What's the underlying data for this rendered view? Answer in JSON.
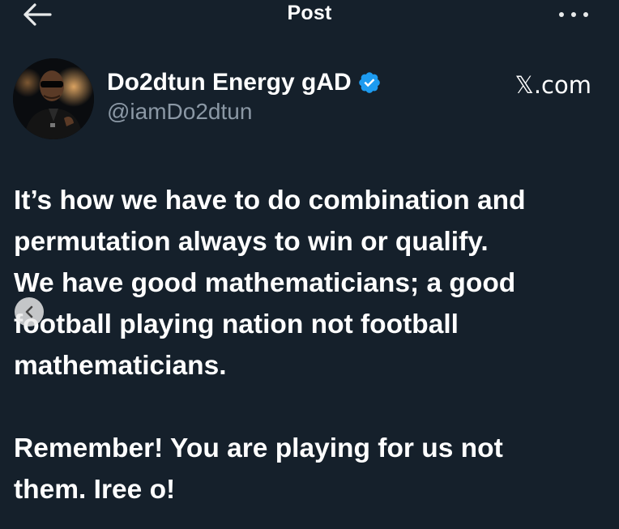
{
  "header": {
    "title": "Post",
    "back_icon": "arrow-left-icon",
    "more_icon": "more-horizontal-icon"
  },
  "author": {
    "display_name": "Do2dtun Energy gAD",
    "handle": "@iamDo2dtun",
    "verified": true,
    "verified_color": "#1d9bf0",
    "avatar": "avatar-photo"
  },
  "watermark": {
    "label": "𝕏.com"
  },
  "post": {
    "paragraphs": [
      "It’s how we have to do combination and\npermutation always to win or qualify.\nWe have good mathematicians; a good\nfootball playing nation not football\nmathematicians.",
      "Remember! You are playing for us not\nthem. Iree o!"
    ]
  },
  "carousel": {
    "prev_icon": "chevron-left-icon"
  },
  "colors": {
    "background": "#15202b",
    "text": "#ffffff",
    "secondary_text": "#8b98a5"
  }
}
